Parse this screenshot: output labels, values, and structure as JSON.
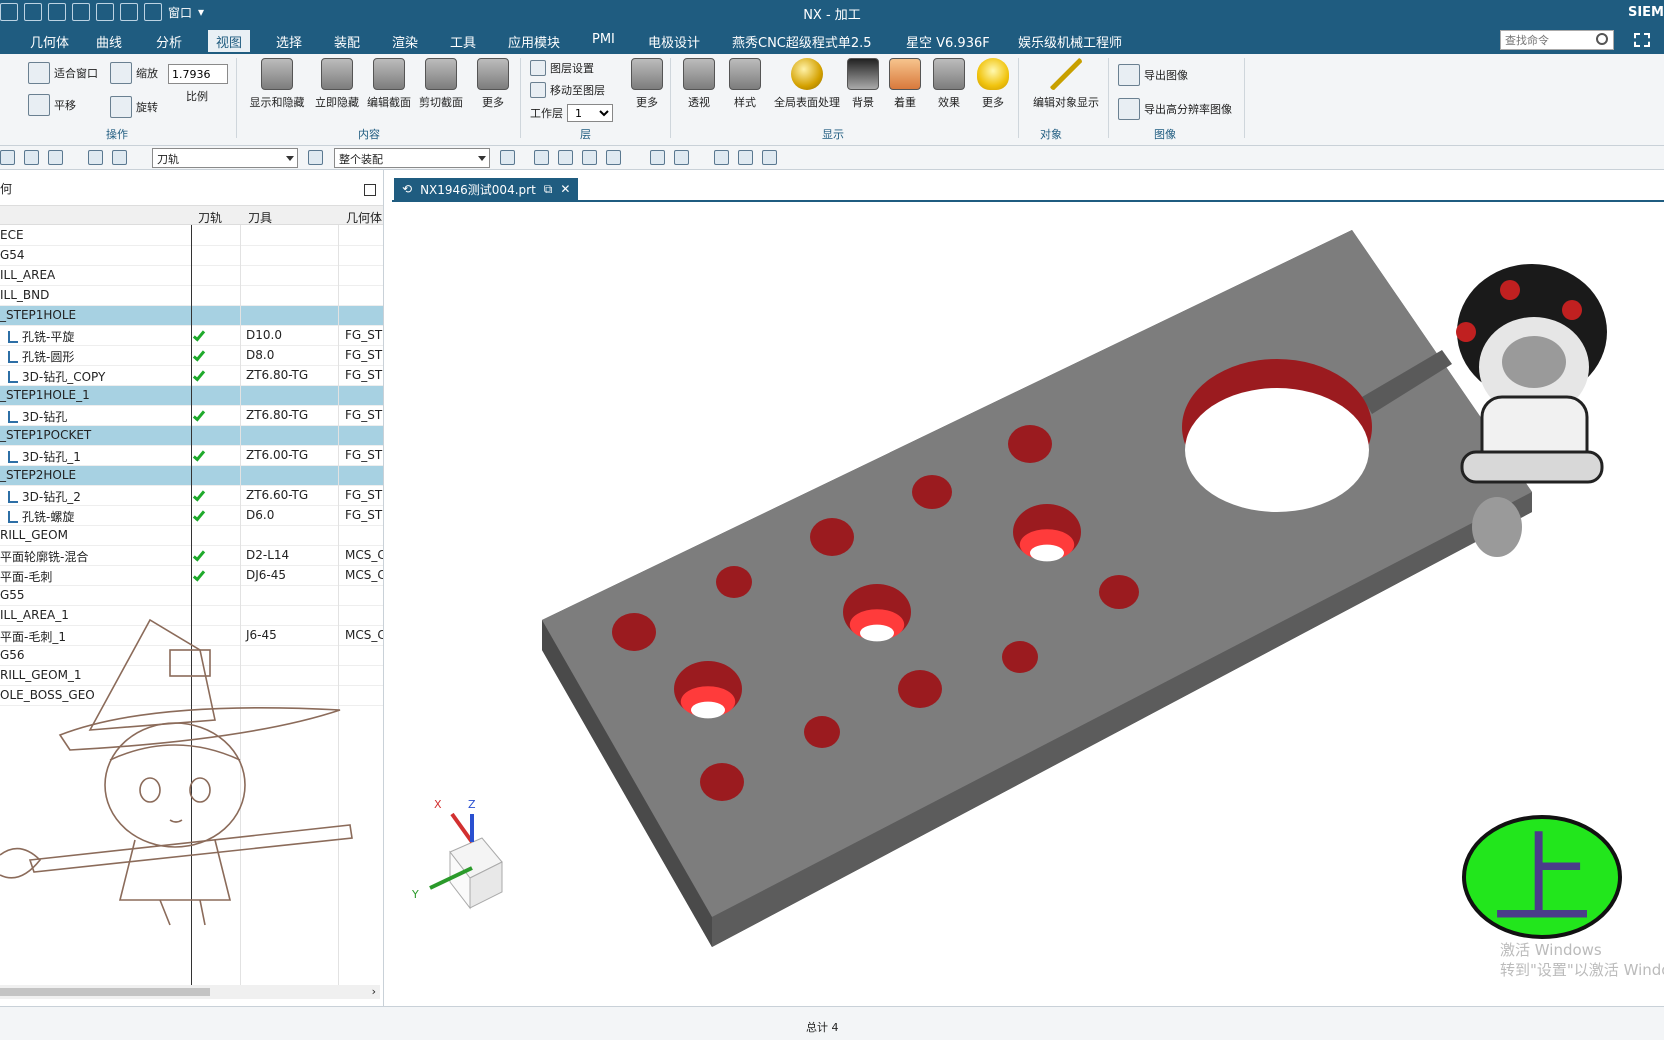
{
  "title_bar": {
    "window_menu_label": "窗口",
    "title": "NX - 加工",
    "brand": "SIEM"
  },
  "menu": {
    "items": [
      "几何体",
      "曲线",
      "分析",
      "视图",
      "选择",
      "装配",
      "渲染",
      "工具",
      "应用模块",
      "PMI",
      "电极设计",
      "燕秀CNC超级程式单2.5",
      "星空 V6.936F",
      "娱乐级机械工程师"
    ],
    "active_index": 3,
    "search_placeholder": "查找命令"
  },
  "ribbon": {
    "operation": {
      "fit_label": "适合窗口",
      "zoom_label": "缩放",
      "scale_value": "1.7936",
      "scale_label": "比例",
      "pan_label": "平移",
      "rotate_label": "旋转",
      "group_label": "操作"
    },
    "content": {
      "buttons": [
        "显示和隐藏",
        "立即隐藏",
        "编辑截面",
        "剪切截面",
        "更多"
      ],
      "group_label": "内容"
    },
    "layer": {
      "layer_settings": "图层设置",
      "move_to_layer": "移动至图层",
      "work_layer_label": "工作层",
      "work_layer_value": "1",
      "more_label": "更多",
      "group_label": "层"
    },
    "display": {
      "buttons": [
        "透视",
        "样式",
        "全局表面处理",
        "背景",
        "着重",
        "效果",
        "更多"
      ],
      "group_label": "显示"
    },
    "object": {
      "edit_display": "编辑对象显示",
      "group_label": "对象"
    },
    "image": {
      "export_image": "导出图像",
      "export_hires": "导出高分辨率图像",
      "group_label": "图像"
    }
  },
  "selection_bar": {
    "filter_value": "刀轨",
    "assembly_value": "整个装配"
  },
  "navigator": {
    "header": "何",
    "columns": [
      "刀轨",
      "刀具",
      "几何体"
    ],
    "rows": [
      {
        "name": "ECE",
        "check": false,
        "tool": "",
        "geom": "",
        "group": false,
        "op": false
      },
      {
        "name": "G54",
        "check": false,
        "tool": "",
        "geom": "",
        "group": false,
        "op": false
      },
      {
        "name": "ILL_AREA",
        "check": false,
        "tool": "",
        "geom": "",
        "group": false,
        "op": false
      },
      {
        "name": "ILL_BND",
        "check": false,
        "tool": "",
        "geom": "",
        "group": false,
        "op": false
      },
      {
        "name": "_STEP1HOLE",
        "check": false,
        "tool": "",
        "geom": "",
        "group": true,
        "op": false
      },
      {
        "name": "孔铣-平旋",
        "check": true,
        "tool": "D10.0",
        "geom": "FG_STE",
        "group": false,
        "op": true
      },
      {
        "name": "孔铣-圆形",
        "check": true,
        "tool": "D8.0",
        "geom": "FG_STE",
        "group": false,
        "op": true
      },
      {
        "name": "3D-钻孔_COPY",
        "check": true,
        "tool": "ZT6.80-TG",
        "geom": "FG_STE",
        "group": false,
        "op": true
      },
      {
        "name": "_STEP1HOLE_1",
        "check": false,
        "tool": "",
        "geom": "",
        "group": true,
        "op": false
      },
      {
        "name": "3D-钻孔",
        "check": true,
        "tool": "ZT6.80-TG",
        "geom": "FG_STE",
        "group": false,
        "op": true
      },
      {
        "name": "_STEP1POCKET",
        "check": false,
        "tool": "",
        "geom": "",
        "group": true,
        "op": false
      },
      {
        "name": "3D-钻孔_1",
        "check": true,
        "tool": "ZT6.00-TG",
        "geom": "FG_STE",
        "group": false,
        "op": true
      },
      {
        "name": "_STEP2HOLE",
        "check": false,
        "tool": "",
        "geom": "",
        "group": true,
        "op": false
      },
      {
        "name": "3D-钻孔_2",
        "check": true,
        "tool": "ZT6.60-TG",
        "geom": "FG_STE",
        "group": false,
        "op": true
      },
      {
        "name": "孔铣-螺旋",
        "check": true,
        "tool": "D6.0",
        "geom": "FG_STE",
        "group": false,
        "op": true
      },
      {
        "name": "RILL_GEOM",
        "check": false,
        "tool": "",
        "geom": "",
        "group": false,
        "op": false
      },
      {
        "name": "平面轮廓铣-混合",
        "check": true,
        "tool": "D2-L14",
        "geom": "MCS_C",
        "group": false,
        "op": false
      },
      {
        "name": "平面-毛刺",
        "check": true,
        "tool": "DJ6-45",
        "geom": "MCS_C",
        "group": false,
        "op": false
      },
      {
        "name": "G55",
        "check": false,
        "tool": "",
        "geom": "",
        "group": false,
        "op": false
      },
      {
        "name": "ILL_AREA_1",
        "check": false,
        "tool": "",
        "geom": "",
        "group": false,
        "op": false
      },
      {
        "name": "平面-毛刺_1",
        "check": false,
        "tool": "J6-45",
        "geom": "MCS_C",
        "group": false,
        "op": false
      },
      {
        "name": "G56",
        "check": false,
        "tool": "",
        "geom": "",
        "group": false,
        "op": false
      },
      {
        "name": "RILL_GEOM_1",
        "check": false,
        "tool": "",
        "geom": "",
        "group": false,
        "op": false
      },
      {
        "name": "OLE_BOSS_GEO",
        "check": false,
        "tool": "",
        "geom": "",
        "group": false,
        "op": false
      }
    ]
  },
  "graphics": {
    "tab_label": "NX1946测试004.prt",
    "triad": {
      "x": "X",
      "y": "Y",
      "z": "Z"
    },
    "sticker_text": "上"
  },
  "watermark": {
    "line1": "激活 Windows",
    "line2": "转到\"设置\"以激活 Windows"
  },
  "status": {
    "total": "总计 4"
  },
  "colors": {
    "theme": "#1f5c80",
    "group_row": "#a7d1e2",
    "part_gray": "#7d7d7d",
    "hole_red": "#9b1b1f",
    "check_green": "#1faa2c",
    "sticker_green": "#22e61c"
  }
}
